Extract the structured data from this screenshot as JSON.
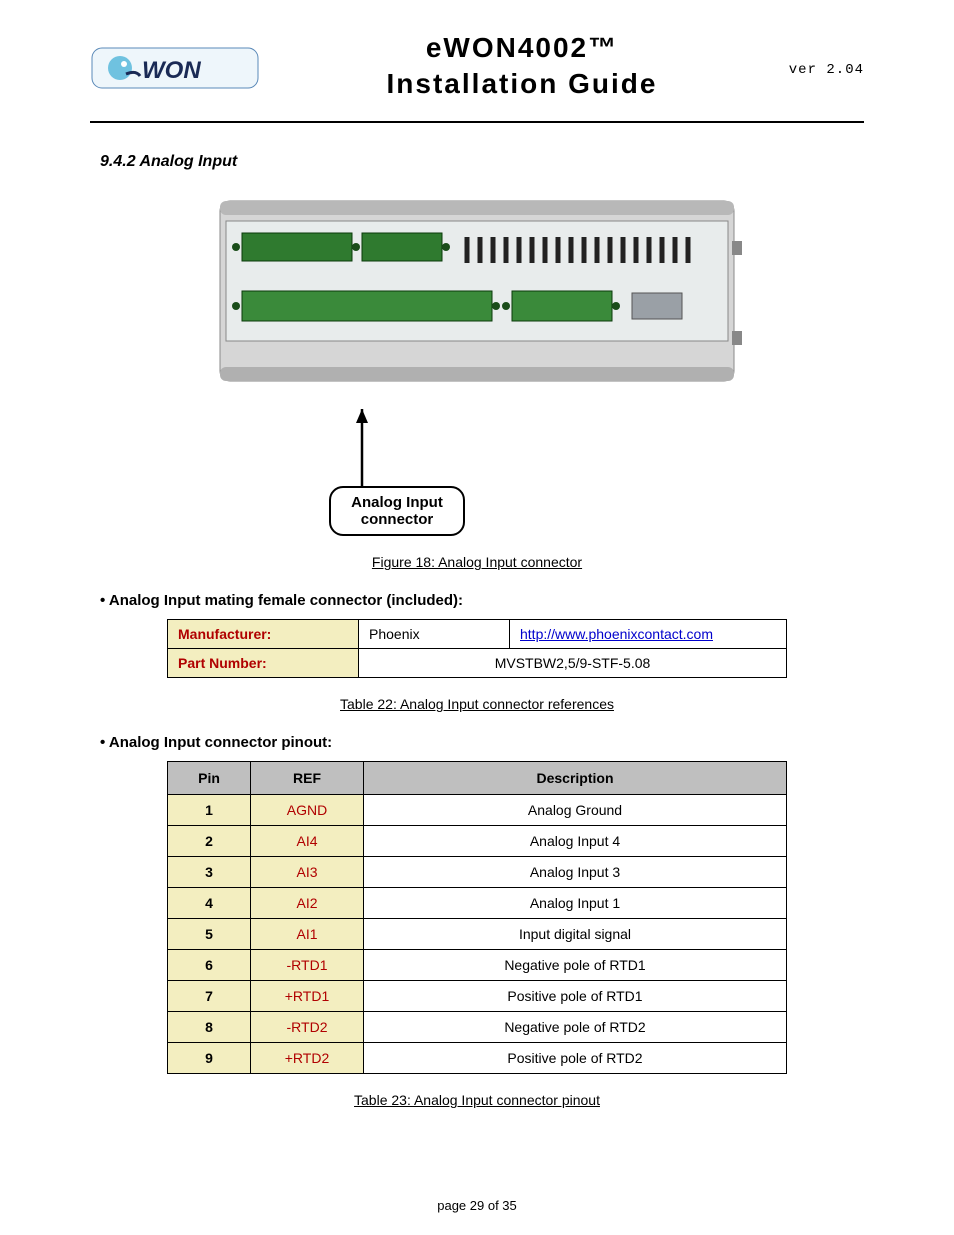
{
  "header": {
    "title_line1": "eWON4002™",
    "title_line2": "Installation Guide",
    "version": "ver 2.04"
  },
  "section_heading": "9.4.2 Analog Input",
  "figure": {
    "callout": "Analog Input\nconnector",
    "callout_line1": "Analog Input",
    "callout_line2": "connector",
    "caption": "Figure 18: Analog Input connector"
  },
  "connector_info": {
    "bullet": "• Analog Input mating female connector (included):",
    "rows": [
      {
        "label": "Manufacturer:",
        "value1": "Phoenix",
        "value2": "http://www.phoenixcontact.com",
        "link": true
      },
      {
        "label": "Part Number:",
        "value_span": "MVSTBW2,5/9-STF-5.08"
      }
    ],
    "caption": "Table 22: Analog Input connector references"
  },
  "pinout": {
    "bullet": "• Analog Input connector pinout:",
    "headers": [
      "Pin",
      "REF",
      "Description"
    ],
    "rows": [
      {
        "pin": "1",
        "ref": "AGND",
        "desc": "Analog Ground"
      },
      {
        "pin": "2",
        "ref": "AI4",
        "desc": "Analog Input 4"
      },
      {
        "pin": "3",
        "ref": "AI3",
        "desc": "Analog Input 3"
      },
      {
        "pin": "4",
        "ref": "AI2",
        "desc": "Analog Input 1"
      },
      {
        "pin": "5",
        "ref": "AI1",
        "desc": "Input digital signal"
      },
      {
        "pin": "6",
        "ref": "-RTD1",
        "desc": "Negative pole of RTD1"
      },
      {
        "pin": "7",
        "ref": "+RTD1",
        "desc": "Positive pole of RTD1"
      },
      {
        "pin": "8",
        "ref": "-RTD2",
        "desc": "Negative pole of RTD2"
      },
      {
        "pin": "9",
        "ref": "+RTD2",
        "desc": "Positive pole of RTD2"
      }
    ],
    "caption": "Table 23: Analog Input connector pinout"
  },
  "footer": "page 29 of 35"
}
